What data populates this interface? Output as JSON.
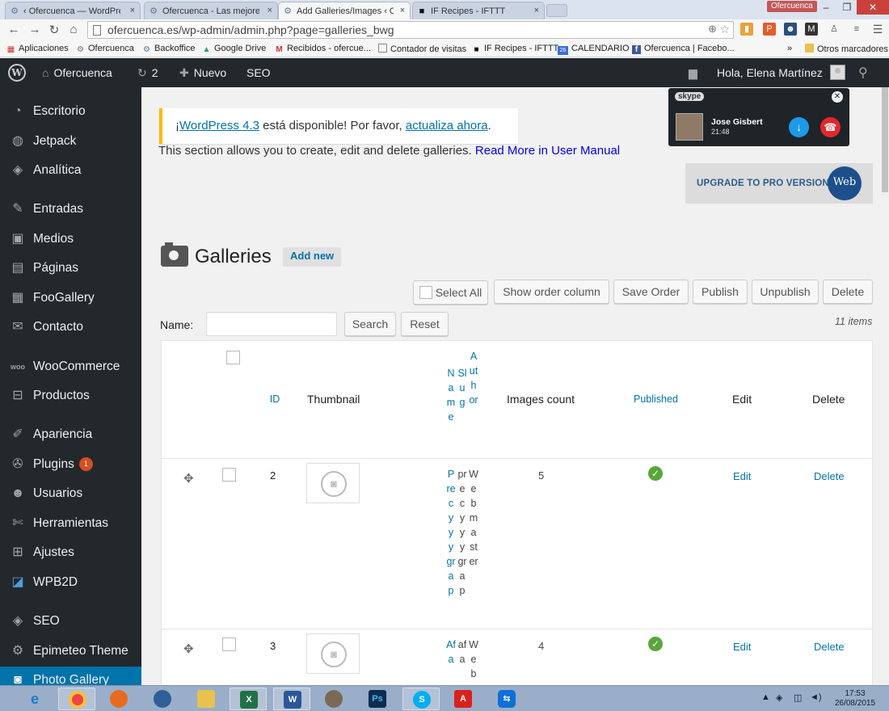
{
  "browser": {
    "tabs": [
      {
        "title": "‹ Ofercuenca — WordPress",
        "active": false
      },
      {
        "title": "Ofercuenca - Las mejores",
        "active": false
      },
      {
        "title": "Add Galleries/Images ‹ Of",
        "active": true
      },
      {
        "title": "IF Recipes - IFTTT",
        "active": false
      }
    ],
    "tab_close": "×",
    "profile": "Ofercuenca",
    "url": "ofercuenca.es/wp-admin/admin.php?page=galleries_bwg",
    "bookmarks": [
      "Aplicaciones",
      "Ofercuenca",
      "Backoffice",
      "Google Drive",
      "Recibidos - ofercue...",
      "Contador de visitas",
      "IF Recipes - IFTTT",
      "CALENDARIO",
      "Ofercuenca | Facebo...",
      "»",
      "Otros marcadores"
    ],
    "calendar_day": "26"
  },
  "adminbar": {
    "site": "Ofercuenca",
    "updates": "2",
    "new": "Nuevo",
    "seo": "SEO",
    "greeting": "Hola, Elena Martínez"
  },
  "sidebar": {
    "items": [
      {
        "label": "Escritorio",
        "icon": "dashboard-icon"
      },
      {
        "label": "Jetpack",
        "icon": "jetpack-icon"
      },
      {
        "label": "Analítica",
        "icon": "analytics-icon"
      },
      {
        "label": "Entradas",
        "icon": "pin-icon"
      },
      {
        "label": "Medios",
        "icon": "media-icon"
      },
      {
        "label": "Páginas",
        "icon": "pages-icon"
      },
      {
        "label": "FooGallery",
        "icon": "gallery-icon"
      },
      {
        "label": "Contacto",
        "icon": "mail-icon"
      },
      {
        "label": "WooCommerce",
        "icon": "woo-icon"
      },
      {
        "label": "Productos",
        "icon": "cart-icon"
      },
      {
        "label": "Apariencia",
        "icon": "brush-icon"
      },
      {
        "label": "Plugins",
        "icon": "plugin-icon",
        "badge": "1"
      },
      {
        "label": "Usuarios",
        "icon": "user-icon"
      },
      {
        "label": "Herramientas",
        "icon": "wrench-icon"
      },
      {
        "label": "Ajustes",
        "icon": "settings-icon"
      },
      {
        "label": "WPB2D",
        "icon": "wpb2d-icon"
      },
      {
        "label": "SEO",
        "icon": "seo-icon"
      },
      {
        "label": "Epimeteo Theme",
        "icon": "gear-icon"
      },
      {
        "label": "Photo Gallery",
        "icon": "photo-icon",
        "current": true
      }
    ]
  },
  "notice": {
    "link1": "WordPress 4.3",
    "text_mid": " está disponible! Por favor, ",
    "link2": "actualiza ahora",
    "text_end": "."
  },
  "intro": {
    "text": "This section allows you to create, edit and delete galleries.",
    "link": "Read More in User Manual"
  },
  "upgrade": {
    "label": "UPGRADE TO PRO VERSION",
    "logo": "Web"
  },
  "page": {
    "title": "Galleries",
    "add_new": "Add new"
  },
  "actions": {
    "select_all": "Select All",
    "show_order": "Show order column",
    "save_order": "Save Order",
    "publish": "Publish",
    "unpublish": "Unpublish",
    "delete": "Delete"
  },
  "filter": {
    "name_label": "Name:",
    "name_value": "",
    "search": "Search",
    "reset": "Reset",
    "count": "11 items"
  },
  "table": {
    "headers": {
      "id": "ID",
      "thumbnail": "Thumbnail",
      "name": "Name",
      "slug": "Slug",
      "author": "Author",
      "images_count": "Images count",
      "published": "Published",
      "edit": "Edit",
      "delete": "Delete"
    },
    "rows": [
      {
        "id": "2",
        "name": "Precyyy grap",
        "slug": "precyyy grap",
        "author": "Webmaster",
        "images_count": "5",
        "edit": "Edit",
        "delete": "Delete"
      },
      {
        "id": "3",
        "name": "Afa",
        "slug": "afa",
        "author": "Web",
        "images_count": "4",
        "edit": "Edit",
        "delete": "Delete"
      }
    ]
  },
  "skype": {
    "brand": "skype",
    "caller": "Jose  Gisbert",
    "time": "21:48"
  },
  "taskbar": {
    "time": "17:53",
    "date": "26/08/2015"
  }
}
